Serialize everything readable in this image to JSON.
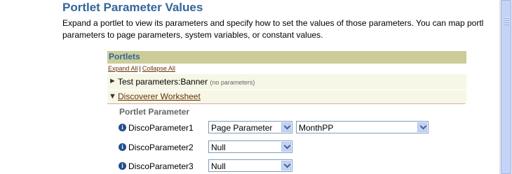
{
  "section": {
    "title": "Portlet Parameter Values",
    "description_line1": "Expand a portlet to view its parameters and specify how to set the values of those parameters. You can map portl",
    "description_line2": "parameters to page parameters, system variables, or constant values."
  },
  "portlets": {
    "header": "Portlets",
    "expand_all": "Expand All",
    "separator": "|",
    "collapse_all": "Collapse All",
    "items": [
      {
        "name": "Test parameters:Banner",
        "note": "(no parameters)",
        "expanded": false
      },
      {
        "name": "Discoverer Worksheet",
        "expanded": true
      }
    ]
  },
  "parameters": {
    "column_label": "Portlet Parameter",
    "rows": [
      {
        "name": "DiscoParameter1",
        "eq": "=",
        "mapping": "Page Parameter",
        "value": "MonthPP"
      },
      {
        "name": "DiscoParameter2",
        "eq": "=",
        "mapping": "Null"
      },
      {
        "name": "DiscoParameter3",
        "eq": "=",
        "mapping": "Null"
      }
    ]
  },
  "icons": {
    "collapsed": "triangle-right-icon",
    "expanded": "triangle-down-icon",
    "info": "info-icon"
  },
  "colors": {
    "title": "#336699",
    "header_bg": "#CCCC99",
    "row_bg": "#F7F7E7",
    "link": "#663300"
  }
}
